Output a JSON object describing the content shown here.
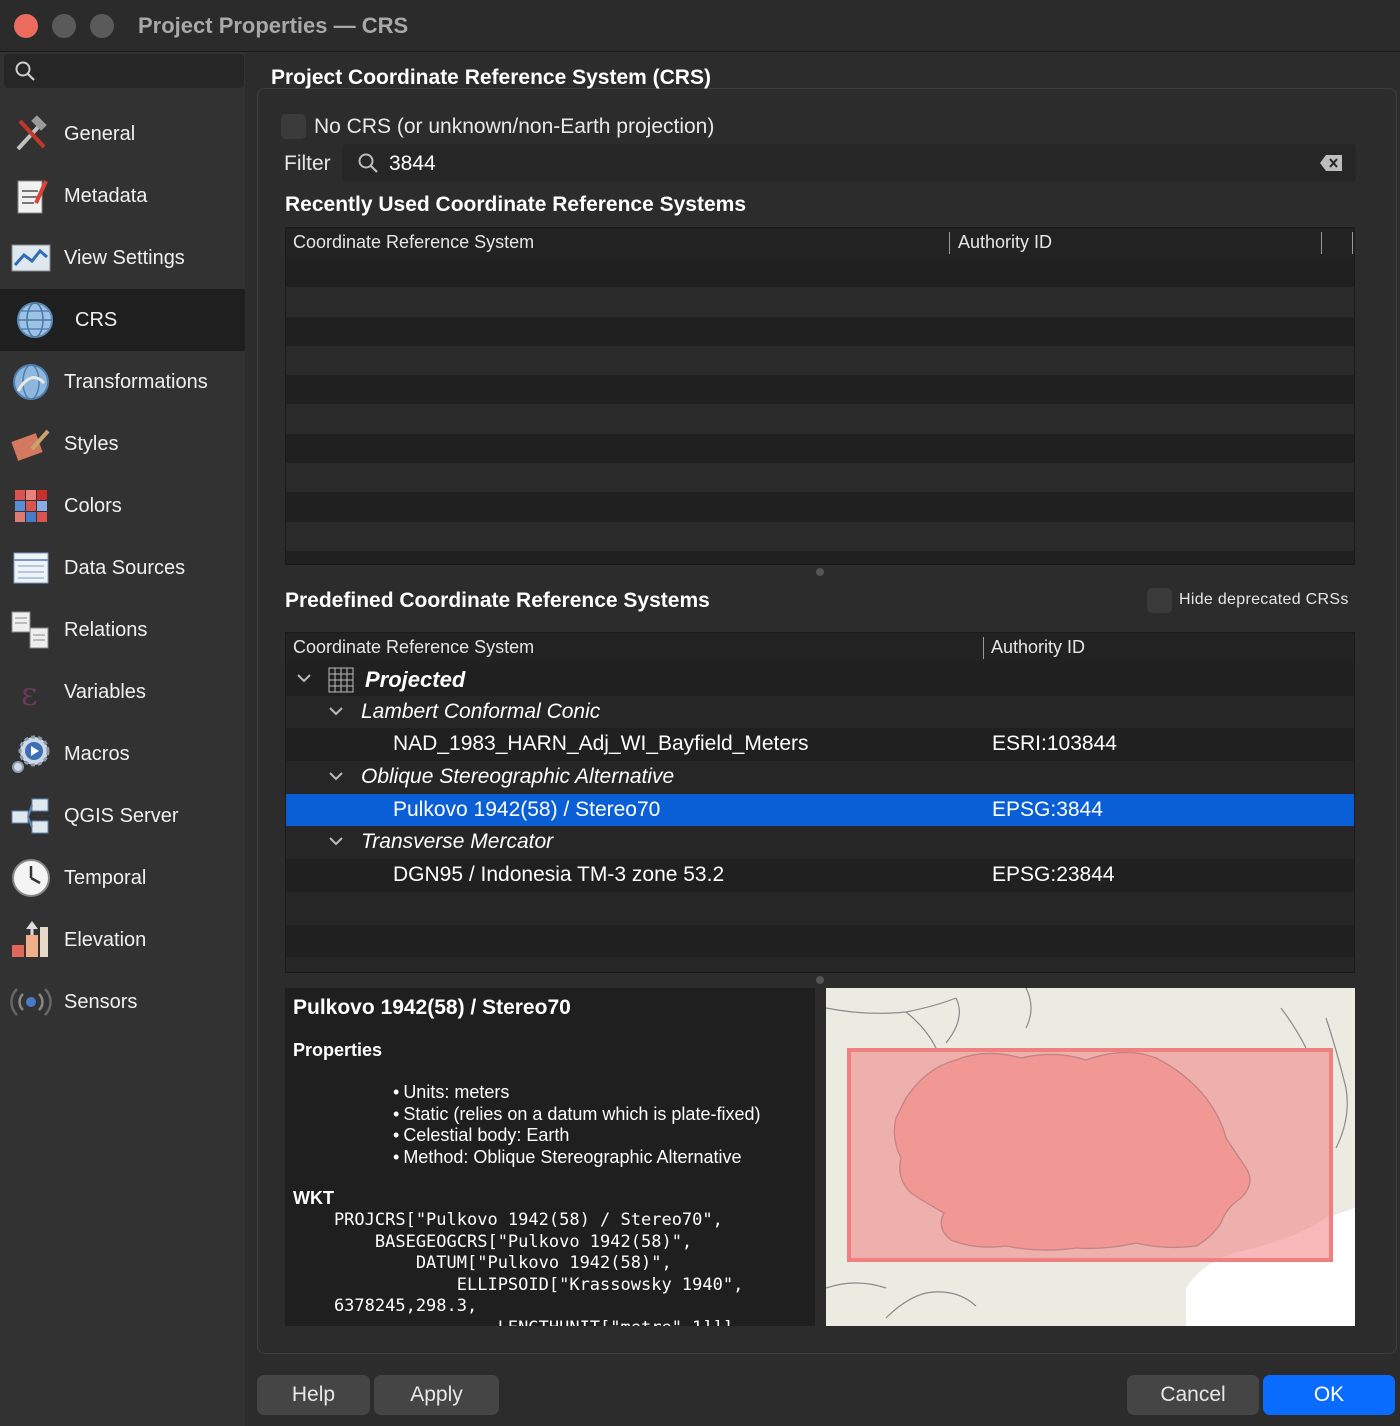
{
  "window": {
    "title": "Project Properties — CRS"
  },
  "sidebar": {
    "search_placeholder": "",
    "items": [
      {
        "label": "General",
        "icon": "general-tools-icon"
      },
      {
        "label": "Metadata",
        "icon": "metadata-icon"
      },
      {
        "label": "View Settings",
        "icon": "view-settings-icon"
      },
      {
        "label": "CRS",
        "icon": "crs-globe-icon",
        "active": true
      },
      {
        "label": "Transformations",
        "icon": "transformations-icon"
      },
      {
        "label": "Styles",
        "icon": "styles-icon"
      },
      {
        "label": "Colors",
        "icon": "colors-icon"
      },
      {
        "label": "Data Sources",
        "icon": "data-sources-icon"
      },
      {
        "label": "Relations",
        "icon": "relations-icon"
      },
      {
        "label": "Variables",
        "icon": "variables-icon"
      },
      {
        "label": "Macros",
        "icon": "macros-icon"
      },
      {
        "label": "QGIS Server",
        "icon": "qgis-server-icon"
      },
      {
        "label": "Temporal",
        "icon": "temporal-clock-icon"
      },
      {
        "label": "Elevation",
        "icon": "elevation-icon"
      },
      {
        "label": "Sensors",
        "icon": "sensors-icon"
      }
    ]
  },
  "main": {
    "group_title": "Project Coordinate Reference System (CRS)",
    "no_crs_label": "No CRS (or unknown/non-Earth projection)",
    "filter_label": "Filter",
    "filter_value": "3844",
    "recent": {
      "title": "Recently Used Coordinate Reference Systems",
      "col_crs": "Coordinate Reference System",
      "col_auth": "Authority ID"
    },
    "predefined": {
      "title": "Predefined Coordinate Reference Systems",
      "hide_deprecated_label": "Hide deprecated CRSs",
      "col_crs": "Coordinate Reference System",
      "col_auth": "Authority ID",
      "rows": [
        {
          "label": "Projected",
          "auth": ""
        },
        {
          "label": "Lambert Conformal Conic",
          "auth": ""
        },
        {
          "label": "NAD_1983_HARN_Adj_WI_Bayfield_Meters",
          "auth": "ESRI:103844"
        },
        {
          "label": "Oblique Stereographic Alternative",
          "auth": ""
        },
        {
          "label": "Pulkovo 1942(58) / Stereo70",
          "auth": "EPSG:3844",
          "selected": true
        },
        {
          "label": "Transverse Mercator",
          "auth": ""
        },
        {
          "label": "DGN95 / Indonesia TM-3 zone 53.2",
          "auth": "EPSG:23844"
        }
      ]
    },
    "info": {
      "title": "Pulkovo 1942(58) / Stereo70",
      "properties_label": "Properties",
      "properties": [
        "Units: meters",
        "Static (relies on a datum which is plate-fixed)",
        "Celestial body: Earth",
        "Method: Oblique Stereographic Alternative"
      ],
      "wkt_label": "WKT",
      "wkt": "    PROJCRS[\"Pulkovo 1942(58) / Stereo70\",\n        BASEGEOGCRS[\"Pulkovo 1942(58)\",\n            DATUM[\"Pulkovo 1942(58)\",\n                ELLIPSOID[\"Krassowsky 1940\",\n    6378245,298.3,\n                    LENGTHUNIT[\"metre\",1]]]"
    }
  },
  "buttons": {
    "help": "Help",
    "apply": "Apply",
    "cancel": "Cancel",
    "ok": "OK"
  },
  "colors": {
    "accent": "#0a6cff",
    "selection": "#0a5fd6",
    "extent_fill": "#f08080"
  }
}
